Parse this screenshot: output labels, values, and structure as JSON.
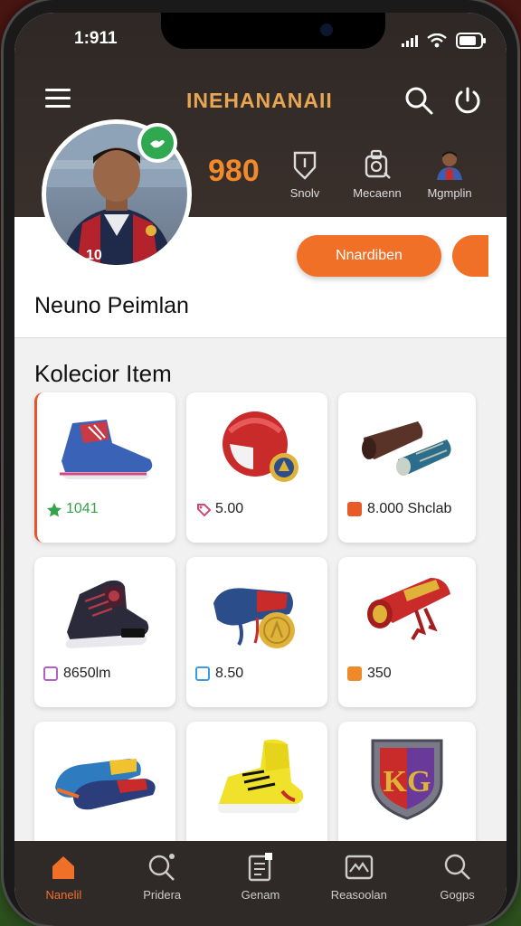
{
  "status_bar": {
    "time": "1:911"
  },
  "header": {
    "app_title": "INEHANANAII",
    "score": "980"
  },
  "stats": [
    {
      "label": "Snolv",
      "icon": "shield-icon"
    },
    {
      "label": "Mecaenn",
      "icon": "bag-icon"
    },
    {
      "label": "Mgmplin",
      "icon": "player-icon"
    }
  ],
  "profile": {
    "name": "Neuno Peimlan",
    "action_label": "Nnardiben"
  },
  "collection": {
    "title": "Kolecior Item",
    "items": [
      {
        "name": "sneaker-blue",
        "price": "1041",
        "price_color": "#36a34b"
      },
      {
        "name": "helmet-red",
        "price": "5.00",
        "price_color": "#c94b7a"
      },
      {
        "name": "guards-pair",
        "price": "8.000 Shclab",
        "price_color": "#e85a27"
      },
      {
        "name": "boot-dark",
        "price": "8650lm",
        "price_color": "#b460c8"
      },
      {
        "name": "gloves-blue",
        "price": "8.50",
        "price_color": "#3a9de0"
      },
      {
        "name": "scroll-red",
        "price": "350",
        "price_color": "#ef8a2a"
      },
      {
        "name": "shoes-pair",
        "price": "",
        "price_color": ""
      },
      {
        "name": "sneaker-yellow",
        "price": "",
        "price_color": ""
      },
      {
        "name": "shield-kg",
        "price": "",
        "price_color": ""
      }
    ],
    "shield_text": "KG"
  },
  "nav": [
    {
      "label": "Nanelil",
      "icon": "home-icon",
      "active": true
    },
    {
      "label": "Pridera",
      "icon": "search-icon",
      "active": false
    },
    {
      "label": "Genam",
      "icon": "notes-icon",
      "active": false
    },
    {
      "label": "Reasoolan",
      "icon": "picture-icon",
      "active": false
    },
    {
      "label": "Gogps",
      "icon": "search-icon",
      "active": false
    }
  ],
  "colors": {
    "accent": "#f07028",
    "score": "#f08a2c",
    "title": "#e7a654",
    "dark": "#2f2a28"
  }
}
